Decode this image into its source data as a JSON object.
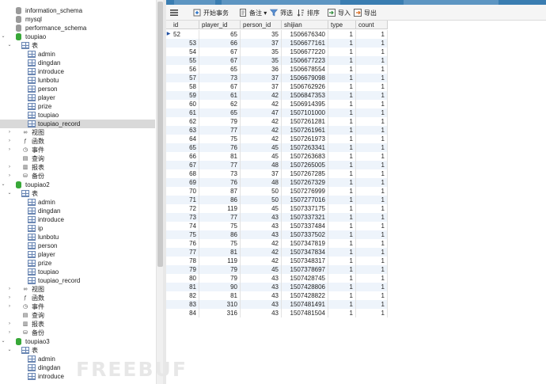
{
  "tree": [
    {
      "label": "information_schema",
      "icon": "db-gray"
    },
    {
      "label": "mysql",
      "icon": "db-gray"
    },
    {
      "label": "performance_schema",
      "icon": "db-gray"
    },
    {
      "label": "toupiao",
      "icon": "db-green",
      "twisty": "⌄"
    },
    {
      "label": "表",
      "icon": "table-folder",
      "twisty": "⌄"
    },
    {
      "label": "admin",
      "icon": "table"
    },
    {
      "label": "dingdan",
      "icon": "table"
    },
    {
      "label": "introduce",
      "icon": "table"
    },
    {
      "label": "lunbotu",
      "icon": "table"
    },
    {
      "label": "person",
      "icon": "table"
    },
    {
      "label": "player",
      "icon": "table"
    },
    {
      "label": "prize",
      "icon": "table"
    },
    {
      "label": "toupiao",
      "icon": "table"
    },
    {
      "label": "toupiao_record",
      "icon": "table",
      "selected": true
    },
    {
      "label": "视图",
      "icon": "view",
      "twisty": "›"
    },
    {
      "label": "函数",
      "icon": "function",
      "twisty": "›"
    },
    {
      "label": "事件",
      "icon": "event",
      "twisty": "›"
    },
    {
      "label": "查询",
      "icon": "query"
    },
    {
      "label": "报表",
      "icon": "report",
      "twisty": "›"
    },
    {
      "label": "备份",
      "icon": "backup",
      "twisty": "›"
    },
    {
      "label": "toupiao2",
      "icon": "db-green",
      "twisty": "⌄"
    },
    {
      "label": "表",
      "icon": "table-folder",
      "twisty": "⌄"
    },
    {
      "label": "admin",
      "icon": "table"
    },
    {
      "label": "dingdan",
      "icon": "table"
    },
    {
      "label": "introduce",
      "icon": "table"
    },
    {
      "label": "ip",
      "icon": "table"
    },
    {
      "label": "lunbotu",
      "icon": "table"
    },
    {
      "label": "person",
      "icon": "table"
    },
    {
      "label": "player",
      "icon": "table"
    },
    {
      "label": "prize",
      "icon": "table"
    },
    {
      "label": "toupiao",
      "icon": "table"
    },
    {
      "label": "toupiao_record",
      "icon": "table"
    },
    {
      "label": "视图",
      "icon": "view",
      "twisty": "›"
    },
    {
      "label": "函数",
      "icon": "function",
      "twisty": "›"
    },
    {
      "label": "事件",
      "icon": "event",
      "twisty": "›"
    },
    {
      "label": "查询",
      "icon": "query"
    },
    {
      "label": "报表",
      "icon": "report",
      "twisty": "›"
    },
    {
      "label": "备份",
      "icon": "backup",
      "twisty": "›"
    },
    {
      "label": "toupiao3",
      "icon": "db-green",
      "twisty": "⌄"
    },
    {
      "label": "表",
      "icon": "table-folder",
      "twisty": "⌄"
    },
    {
      "label": "admin",
      "icon": "table"
    },
    {
      "label": "dingdan",
      "icon": "table"
    },
    {
      "label": "introduce",
      "icon": "table"
    }
  ],
  "toolbar": {
    "menu_icon": "menu-icon",
    "begin_transaction": "开始事务",
    "note": "备注",
    "filter": "筛选",
    "sort": "排序",
    "import": "导入",
    "export": "导出"
  },
  "columns": [
    "id",
    "player_id",
    "person_id",
    "shijian",
    "type",
    "count"
  ],
  "rows": [
    [
      "52",
      "65",
      "35",
      "1506676340",
      "1",
      "1"
    ],
    [
      "53",
      "66",
      "37",
      "1506677161",
      "1",
      "1"
    ],
    [
      "54",
      "67",
      "35",
      "1506677220",
      "1",
      "1"
    ],
    [
      "55",
      "67",
      "35",
      "1506677223",
      "1",
      "1"
    ],
    [
      "56",
      "65",
      "36",
      "1506678554",
      "1",
      "1"
    ],
    [
      "57",
      "73",
      "37",
      "1506679098",
      "1",
      "1"
    ],
    [
      "58",
      "67",
      "37",
      "1506762926",
      "1",
      "1"
    ],
    [
      "59",
      "61",
      "42",
      "1506847353",
      "1",
      "1"
    ],
    [
      "60",
      "62",
      "42",
      "1506914395",
      "1",
      "1"
    ],
    [
      "61",
      "65",
      "47",
      "1507101000",
      "1",
      "1"
    ],
    [
      "62",
      "79",
      "42",
      "1507261281",
      "1",
      "1"
    ],
    [
      "63",
      "77",
      "42",
      "1507261961",
      "1",
      "1"
    ],
    [
      "64",
      "75",
      "42",
      "1507261973",
      "1",
      "1"
    ],
    [
      "65",
      "76",
      "45",
      "1507263341",
      "1",
      "1"
    ],
    [
      "66",
      "81",
      "45",
      "1507263683",
      "1",
      "1"
    ],
    [
      "67",
      "77",
      "48",
      "1507265005",
      "1",
      "1"
    ],
    [
      "68",
      "73",
      "37",
      "1507267285",
      "1",
      "1"
    ],
    [
      "69",
      "76",
      "48",
      "1507267329",
      "1",
      "1"
    ],
    [
      "70",
      "87",
      "50",
      "1507276999",
      "1",
      "1"
    ],
    [
      "71",
      "86",
      "50",
      "1507277016",
      "1",
      "1"
    ],
    [
      "72",
      "119",
      "45",
      "1507337175",
      "1",
      "1"
    ],
    [
      "73",
      "77",
      "43",
      "1507337321",
      "1",
      "1"
    ],
    [
      "74",
      "75",
      "43",
      "1507337484",
      "1",
      "1"
    ],
    [
      "75",
      "86",
      "43",
      "1507337502",
      "1",
      "1"
    ],
    [
      "76",
      "75",
      "42",
      "1507347819",
      "1",
      "1"
    ],
    [
      "77",
      "81",
      "42",
      "1507347834",
      "1",
      "1"
    ],
    [
      "78",
      "119",
      "42",
      "1507348317",
      "1",
      "1"
    ],
    [
      "79",
      "79",
      "45",
      "1507378697",
      "1",
      "1"
    ],
    [
      "80",
      "79",
      "43",
      "1507428745",
      "1",
      "1"
    ],
    [
      "81",
      "90",
      "43",
      "1507428806",
      "1",
      "1"
    ],
    [
      "82",
      "81",
      "43",
      "1507428822",
      "1",
      "1"
    ],
    [
      "83",
      "310",
      "43",
      "1507481491",
      "1",
      "1"
    ],
    [
      "84",
      "316",
      "43",
      "1507481504",
      "1",
      "1"
    ]
  ],
  "watermark": "FREEBUF"
}
